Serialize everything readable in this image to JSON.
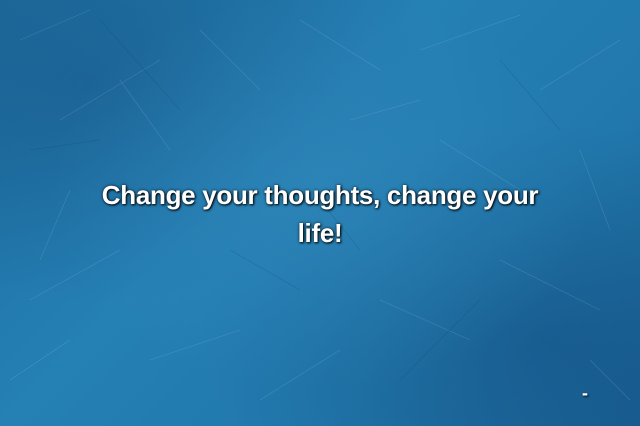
{
  "quote": {
    "text": "Change your thoughts, change your life!",
    "author": "-"
  },
  "background": {
    "base_color": "#2178ac",
    "texture": "scratched-paper"
  }
}
